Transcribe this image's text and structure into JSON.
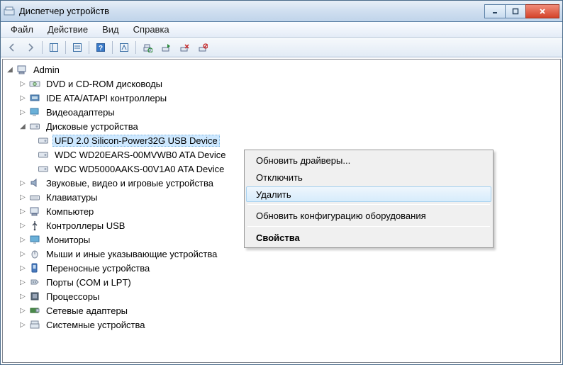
{
  "titlebar": {
    "title": "Диспетчер устройств"
  },
  "menubar": {
    "file": "Файл",
    "action": "Действие",
    "view": "Вид",
    "help": "Справка"
  },
  "tree": {
    "root": "Admin",
    "items": [
      {
        "label": "DVD и CD-ROM дисководы"
      },
      {
        "label": "IDE ATA/ATAPI контроллеры"
      },
      {
        "label": "Видеоадаптеры"
      },
      {
        "label": "Дисковые устройства",
        "expanded": true,
        "children": [
          "UFD 2.0 Silicon-Power32G USB Device",
          "WDC WD20EARS-00MVWB0 ATA Device",
          "WDC WD5000AAKS-00V1A0 ATA Device"
        ]
      },
      {
        "label": "Звуковые, видео и игровые устройства"
      },
      {
        "label": "Клавиатуры"
      },
      {
        "label": "Компьютер"
      },
      {
        "label": "Контроллеры USB"
      },
      {
        "label": "Мониторы"
      },
      {
        "label": "Мыши и иные указывающие устройства"
      },
      {
        "label": "Переносные устройства"
      },
      {
        "label": "Порты (COM и LPT)"
      },
      {
        "label": "Процессоры"
      },
      {
        "label": "Сетевые адаптеры"
      },
      {
        "label": "Системные устройства"
      }
    ]
  },
  "context_menu": {
    "update_drivers": "Обновить драйверы...",
    "disable": "Отключить",
    "delete": "Удалить",
    "scan_hw": "Обновить конфигурацию оборудования",
    "properties": "Свойства"
  }
}
